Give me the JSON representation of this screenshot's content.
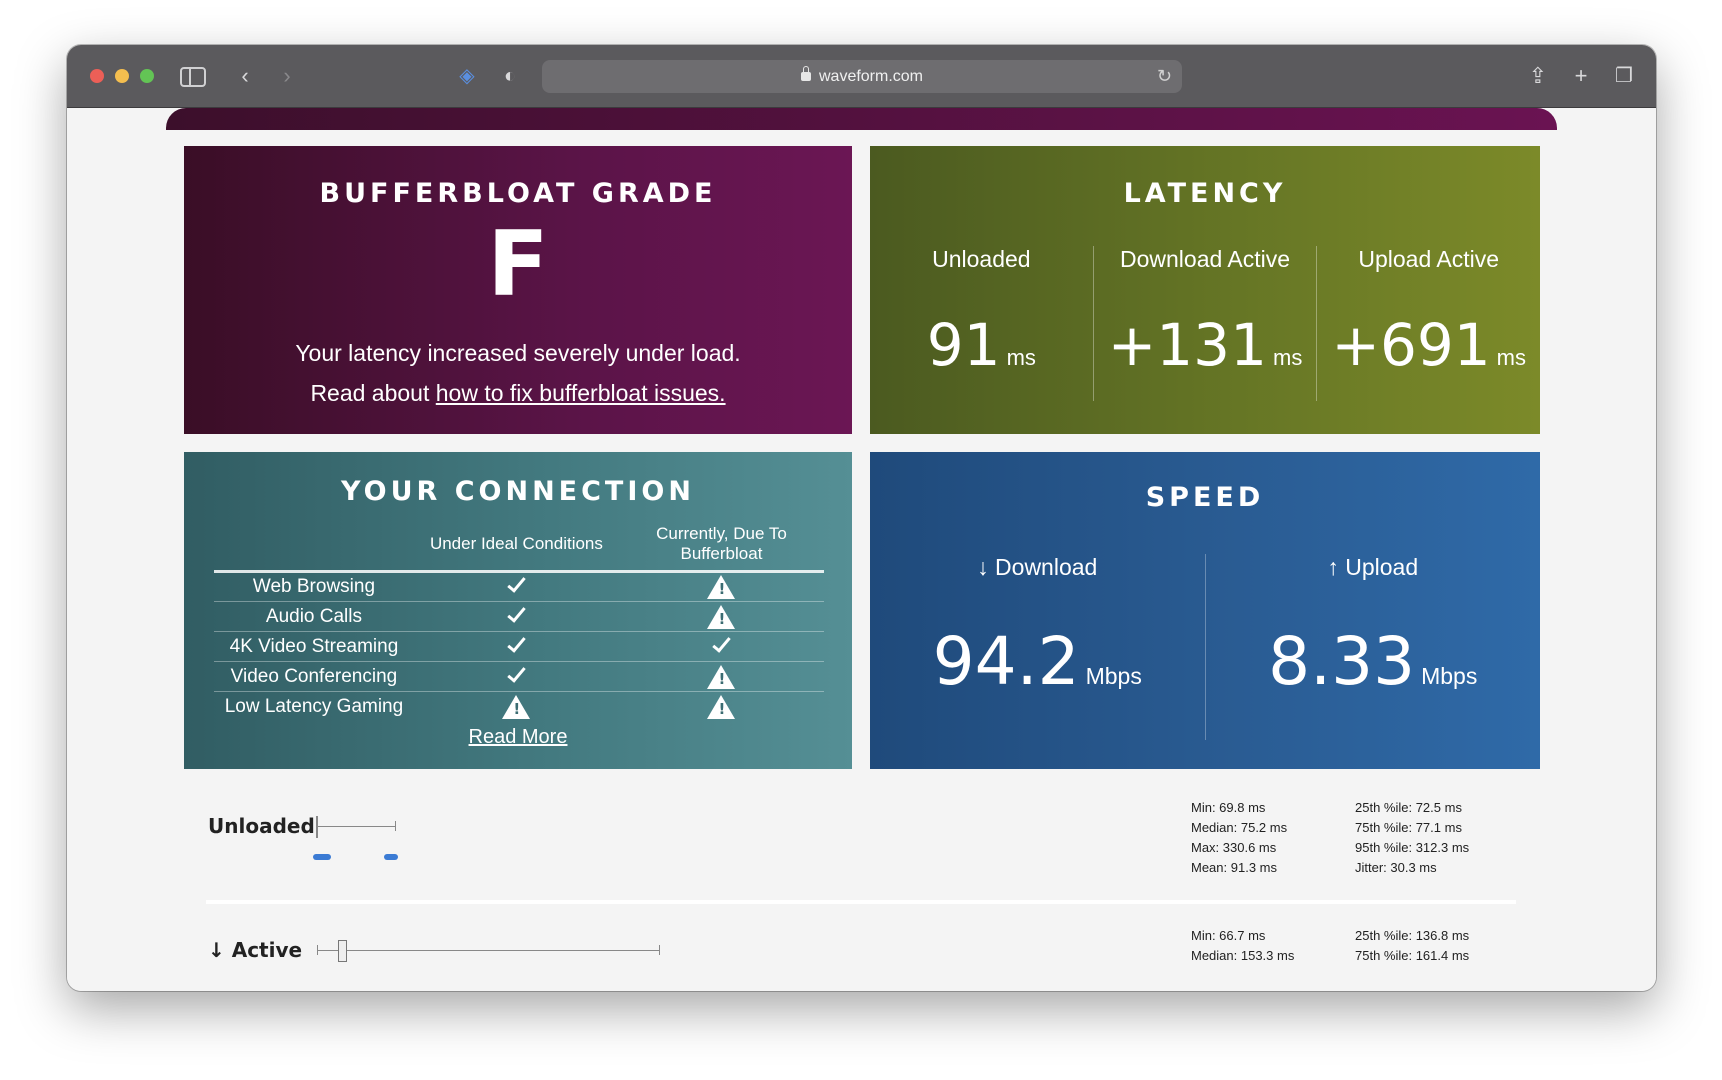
{
  "browser": {
    "url": "waveform.com"
  },
  "grade": {
    "title": "BUFFERBLOAT GRADE",
    "letter": "F",
    "message": "Your latency increased severely under load.",
    "read_prefix": "Read about ",
    "link_text": "how to fix bufferbloat issues."
  },
  "latency": {
    "title": "LATENCY",
    "columns": [
      {
        "label": "Unloaded",
        "value": "91",
        "unit": "ms"
      },
      {
        "label": "Download Active",
        "value": "+131",
        "unit": "ms"
      },
      {
        "label": "Upload Active",
        "value": "+691",
        "unit": "ms"
      }
    ]
  },
  "connection": {
    "title": "YOUR CONNECTION",
    "headers": [
      "Under Ideal Conditions",
      "Currently, Due To Bufferbloat"
    ],
    "rows": [
      {
        "activity": "Web Browsing",
        "ideal": "check",
        "current": "warning"
      },
      {
        "activity": "Audio Calls",
        "ideal": "check",
        "current": "warning"
      },
      {
        "activity": "4K Video Streaming",
        "ideal": "check",
        "current": "check"
      },
      {
        "activity": "Video Conferencing",
        "ideal": "check",
        "current": "warning"
      },
      {
        "activity": "Low Latency Gaming",
        "ideal": "warning",
        "current": "warning"
      }
    ],
    "read_more": "Read More"
  },
  "speed": {
    "title": "SPEED",
    "download": {
      "label": "↓ Download",
      "value": "94.2",
      "unit": "Mbps"
    },
    "upload": {
      "label": "↑ Upload",
      "value": "8.33",
      "unit": "Mbps"
    }
  },
  "details": {
    "unloaded": {
      "label": "Unloaded",
      "stats_left": [
        "Min: 69.8 ms",
        "Median: 75.2 ms",
        "Max: 330.6 ms",
        "Mean: 91.3 ms"
      ],
      "stats_right": [
        "25th %ile: 72.5 ms",
        "75th %ile: 77.1 ms",
        "95th %ile: 312.3 ms",
        "Jitter: 30.3 ms"
      ]
    },
    "active": {
      "label": "↓ Active",
      "stats_left": [
        "Min: 66.7 ms",
        "Median: 153.3 ms"
      ],
      "stats_right": [
        "25th %ile: 136.8 ms",
        "75th %ile: 161.4 ms"
      ]
    }
  },
  "colors": {
    "grade_bg": "#5b1448",
    "latency_bg": "#667625",
    "connection_bg": "#437a80",
    "speed_bg": "#2a5c93",
    "dot": "#3b7bd4"
  }
}
